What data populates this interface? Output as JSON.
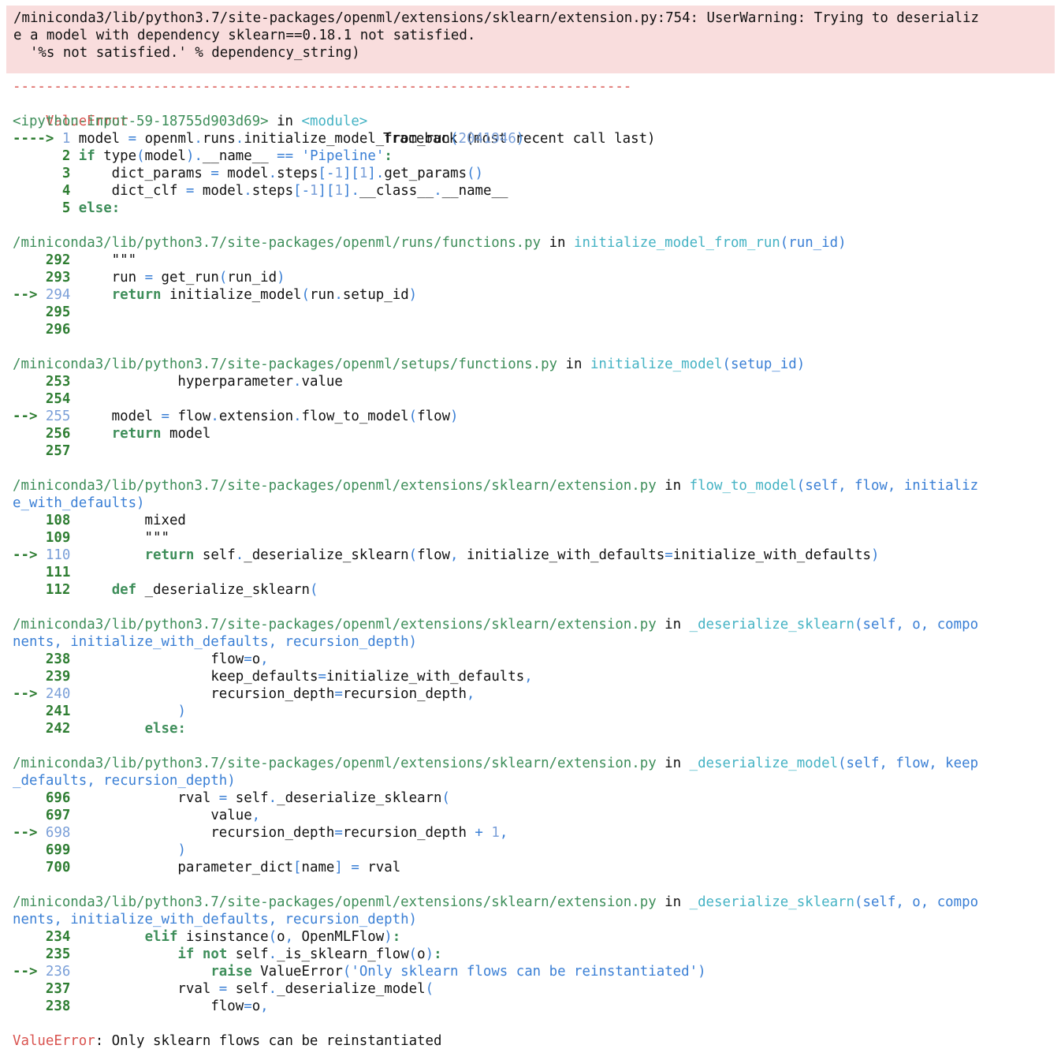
{
  "warning": {
    "lines": [
      "/miniconda3/lib/python3.7/site-packages/openml/extensions/sklearn/extension.py:754: UserWarning: Trying to deserializ",
      "e a model with dependency sklearn==0.18.1 not satisfied.",
      "  '%s not satisfied.' % dependency_string)"
    ]
  },
  "traceback": {
    "separator": "---------------------------------------------------------------------------",
    "error_type": "ValueError",
    "header_right": "Traceback (most recent call last)",
    "input_cell": "<ipython-input-59-18755d903d69>",
    "in_word": "in",
    "module": "<module>",
    "cell_lines": [
      {
        "marker": "----> ",
        "num": "1",
        "code": "model = openml.runs.initialize_model_from_run(2041946)"
      },
      {
        "marker": "      ",
        "num": "2",
        "code": "if type(model).__name__ == 'Pipeline':"
      },
      {
        "marker": "      ",
        "num": "3",
        "code": "    dict_params = model.steps[-1][1].get_params()"
      },
      {
        "marker": "      ",
        "num": "4",
        "code": "    dict_clf = model.steps[-1][1].__class__.__name__"
      },
      {
        "marker": "      ",
        "num": "5",
        "code": "else:"
      }
    ],
    "frames": [
      {
        "path": "/miniconda3/lib/python3.7/site-packages/openml/runs/functions.py",
        "in": "in",
        "func": "initialize_model_from_run",
        "args": "(run_id)",
        "lines": [
          {
            "marker": "    ",
            "num": "292",
            "code": "    \"\"\""
          },
          {
            "marker": "    ",
            "num": "293",
            "code": "    run = get_run(run_id)"
          },
          {
            "marker": "--> ",
            "num": "294",
            "code": "    return initialize_model(run.setup_id)"
          },
          {
            "marker": "    ",
            "num": "295",
            "code": ""
          },
          {
            "marker": "    ",
            "num": "296",
            "code": ""
          }
        ]
      },
      {
        "path": "/miniconda3/lib/python3.7/site-packages/openml/setups/functions.py",
        "in": "in",
        "func": "initialize_model",
        "args": "(setup_id)",
        "lines": [
          {
            "marker": "    ",
            "num": "253",
            "code": "            hyperparameter.value"
          },
          {
            "marker": "    ",
            "num": "254",
            "code": ""
          },
          {
            "marker": "--> ",
            "num": "255",
            "code": "    model = flow.extension.flow_to_model(flow)"
          },
          {
            "marker": "    ",
            "num": "256",
            "code": "    return model"
          },
          {
            "marker": "    ",
            "num": "257",
            "code": ""
          }
        ]
      },
      {
        "path": "/miniconda3/lib/python3.7/site-packages/openml/extensions/sklearn/extension.py",
        "in": "in",
        "func": "flow_to_model",
        "args": "(self, flow, initializ",
        "args2": "e_with_defaults)",
        "lines": [
          {
            "marker": "    ",
            "num": "108",
            "code": "        mixed"
          },
          {
            "marker": "    ",
            "num": "109",
            "code": "        \"\"\""
          },
          {
            "marker": "--> ",
            "num": "110",
            "code": "        return self._deserialize_sklearn(flow, initialize_with_defaults=initialize_with_defaults)"
          },
          {
            "marker": "    ",
            "num": "111",
            "code": ""
          },
          {
            "marker": "    ",
            "num": "112",
            "code": "    def _deserialize_sklearn("
          }
        ]
      },
      {
        "path": "/miniconda3/lib/python3.7/site-packages/openml/extensions/sklearn/extension.py",
        "in": "in",
        "func": "_deserialize_sklearn",
        "args": "(self, o, compo",
        "args2": "nents, initialize_with_defaults, recursion_depth)",
        "lines": [
          {
            "marker": "    ",
            "num": "238",
            "code": "                flow=o,"
          },
          {
            "marker": "    ",
            "num": "239",
            "code": "                keep_defaults=initialize_with_defaults,"
          },
          {
            "marker": "--> ",
            "num": "240",
            "code": "                recursion_depth=recursion_depth,"
          },
          {
            "marker": "    ",
            "num": "241",
            "code": "            )"
          },
          {
            "marker": "    ",
            "num": "242",
            "code": "        else:"
          }
        ]
      },
      {
        "path": "/miniconda3/lib/python3.7/site-packages/openml/extensions/sklearn/extension.py",
        "in": "in",
        "func": "_deserialize_model",
        "args": "(self, flow, keep",
        "args2": "_defaults, recursion_depth)",
        "lines": [
          {
            "marker": "    ",
            "num": "696",
            "code": "            rval = self._deserialize_sklearn("
          },
          {
            "marker": "    ",
            "num": "697",
            "code": "                value,"
          },
          {
            "marker": "--> ",
            "num": "698",
            "code": "                recursion_depth=recursion_depth + 1,"
          },
          {
            "marker": "    ",
            "num": "699",
            "code": "            )"
          },
          {
            "marker": "    ",
            "num": "700",
            "code": "            parameter_dict[name] = rval"
          }
        ]
      },
      {
        "path": "/miniconda3/lib/python3.7/site-packages/openml/extensions/sklearn/extension.py",
        "in": "in",
        "func": "_deserialize_sklearn",
        "args": "(self, o, compo",
        "args2": "nents, initialize_with_defaults, recursion_depth)",
        "lines": [
          {
            "marker": "    ",
            "num": "234",
            "code": "        elif isinstance(o, OpenMLFlow):"
          },
          {
            "marker": "    ",
            "num": "235",
            "code": "            if not self._is_sklearn_flow(o):"
          },
          {
            "marker": "--> ",
            "num": "236",
            "code": "                raise ValueError('Only sklearn flows can be reinstantiated')"
          },
          {
            "marker": "    ",
            "num": "237",
            "code": "            rval = self._deserialize_model("
          },
          {
            "marker": "    ",
            "num": "238",
            "code": "                flow=o,"
          }
        ]
      }
    ],
    "final_error_type": "ValueError",
    "final_message": ": Only sklearn flows can be reinstantiated"
  }
}
